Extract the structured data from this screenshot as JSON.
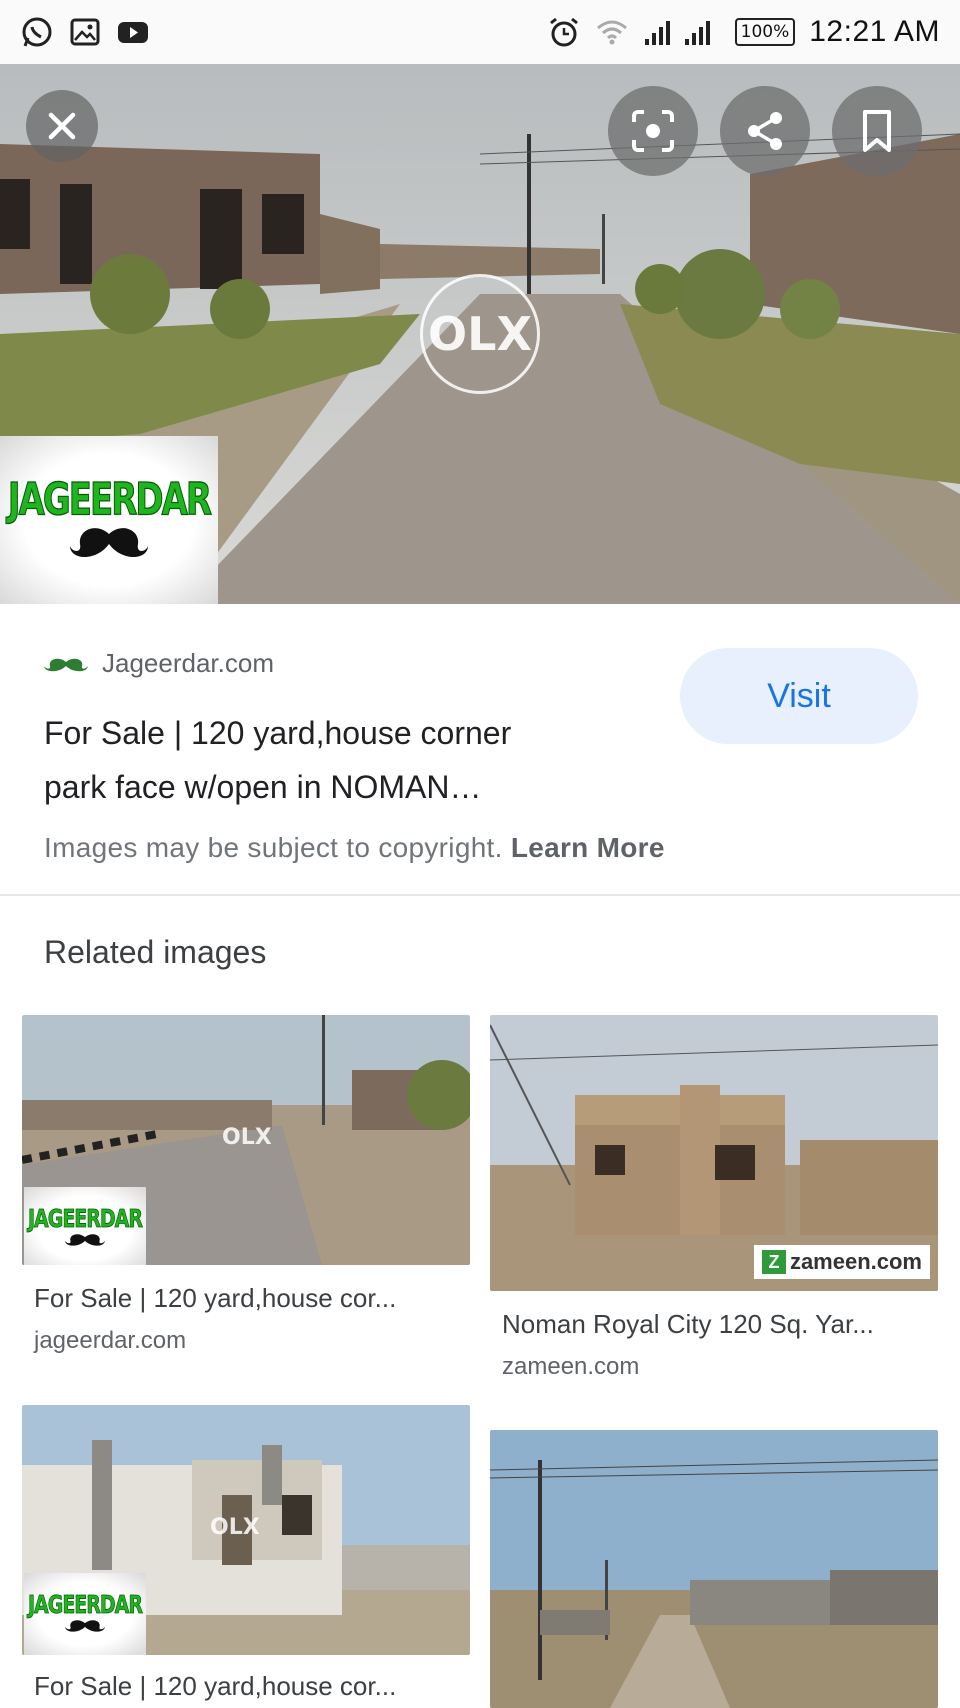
{
  "status_bar": {
    "left_icons": [
      "whatsapp-icon",
      "gallery-icon",
      "youtube-icon"
    ],
    "right_icons": [
      "alarm-icon",
      "wifi-icon",
      "signal-icon"
    ],
    "battery": "100%",
    "time": "12:21 AM"
  },
  "hero": {
    "watermark": "OLX",
    "logo_text": "JAGEERDAR",
    "buttons": [
      "close-icon",
      "lens-icon",
      "share-icon",
      "bookmark-icon"
    ]
  },
  "result": {
    "source": "Jageerdar.com",
    "title_line1": "For Sale | 120 yard,house corner",
    "title_line2": "park face w/open in NOMAN…",
    "visit_label": "Visit",
    "copyright_text": "Images may be subject to copyright.",
    "learn_more": "Learn More"
  },
  "related": {
    "heading": "Related images",
    "items": [
      {
        "caption": "For Sale | 120 yard,house cor...",
        "domain": "jageerdar.com",
        "logo_text": "JAGEERDAR",
        "watermark": "OLX"
      },
      {
        "caption": "Noman Royal City 120 Sq. Yar...",
        "domain": "zameen.com",
        "badge": "zameen.com"
      },
      {
        "caption": "For Sale | 120 yard,house cor...",
        "logo_text": "JAGEERDAR",
        "watermark": "OLX"
      },
      {
        "caption": ""
      }
    ]
  },
  "colors": {
    "accent": "#1a73e8",
    "visit_bg": "#e8f0fe",
    "logo_green": "#1fb51f"
  }
}
